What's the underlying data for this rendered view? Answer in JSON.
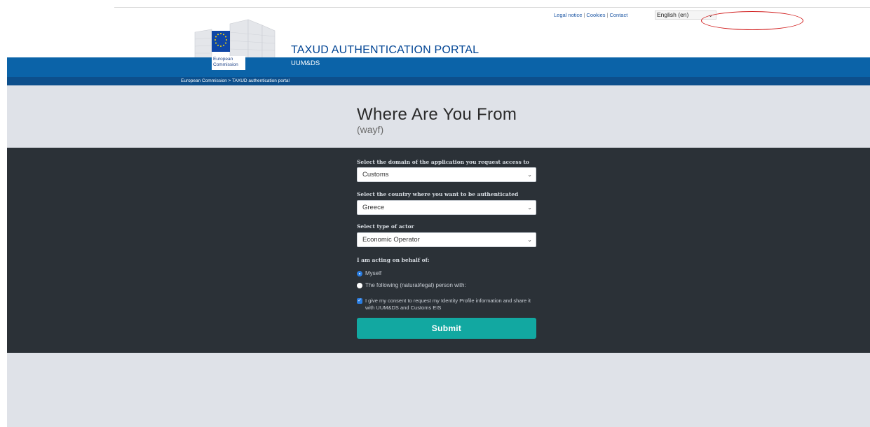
{
  "header": {
    "utility_links": [
      "Legal notice",
      "Cookies",
      "Contact"
    ],
    "separator": "|",
    "language": "English (en)",
    "portal_title": "TAXUD AUTHENTICATION PORTAL",
    "portal_subtitle": "UUM&DS",
    "logo_line1": "European",
    "logo_line2": "Commission",
    "breadcrumb": "European Commission > TAXUD authentication portal"
  },
  "hero": {
    "title": "Where Are You From",
    "subtitle": "(wayf)"
  },
  "form": {
    "domain_label": "Select the domain of the application you request access to",
    "domain_value": "Customs",
    "country_label": "Select the country where you want to be authenticated",
    "country_value": "Greece",
    "actor_label": "Select type of actor",
    "actor_value": "Economic Operator",
    "behalf_label": "I am acting on behalf of:",
    "option_myself": "Myself",
    "option_other": "The following (natural/legal) person with:",
    "consent_text": "I give my consent to request my Identity Profile information and share it with UUM&DS and Customs EIS",
    "submit_label": "Submit"
  },
  "colors": {
    "brand_blue": "#0b63a8",
    "submit_teal": "#12a8a1",
    "dark_band": "#2b3137",
    "annotation_red": "#d01818"
  }
}
